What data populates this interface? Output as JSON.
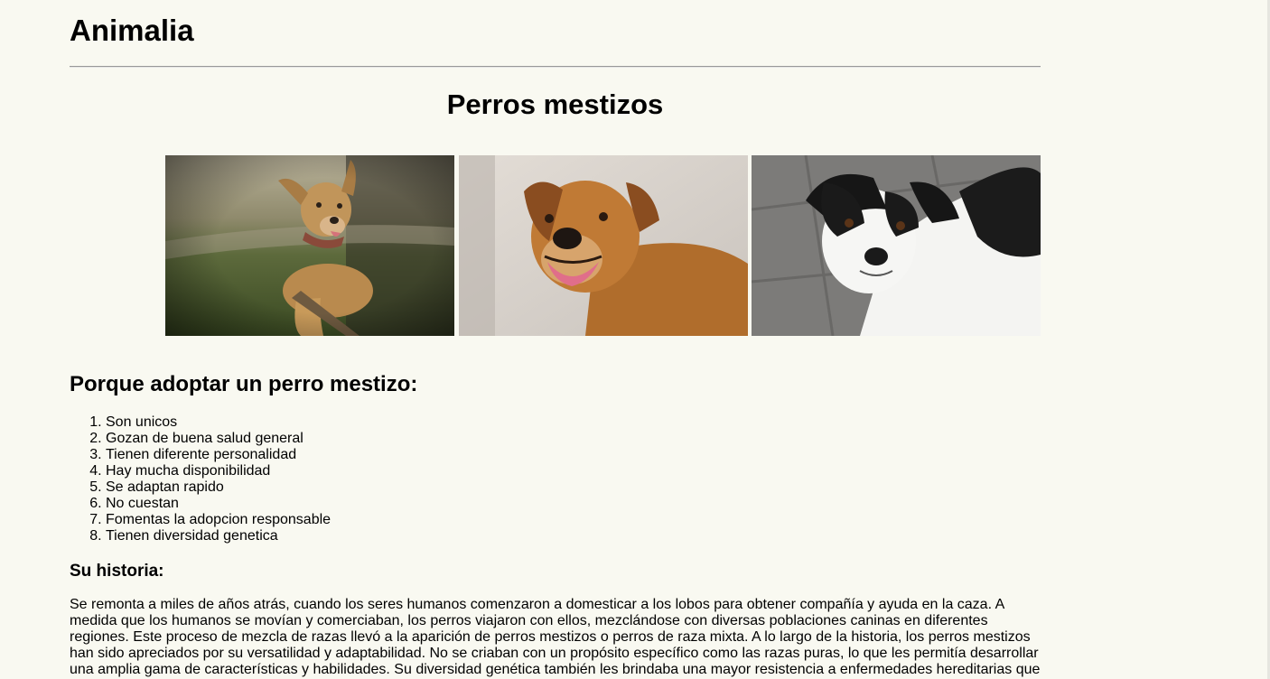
{
  "site": {
    "title": "Animalia"
  },
  "page": {
    "title": "Perros mestizos"
  },
  "gallery": {
    "images": [
      {
        "alt": "perro mestizo marrón en el césped con un palo"
      },
      {
        "alt": "perro mestizo color caramelo"
      },
      {
        "alt": "perro mestizo blanco y negro"
      }
    ]
  },
  "reasons": {
    "heading": "Porque adoptar un perro mestizo:",
    "items": [
      "Son unicos",
      "Gozan de buena salud general",
      "Tienen diferente personalidad",
      "Hay mucha disponibilidad",
      "Se adaptan rapido",
      "No cuestan",
      "Fomentas la adopcion responsable",
      "Tienen diversidad genetica"
    ]
  },
  "history": {
    "heading": "Su historia:",
    "text": "Se remonta a miles de años atrás, cuando los seres humanos comenzaron a domesticar a los lobos para obtener compañía y ayuda en la caza. A medida que los humanos se movían y comerciaban, los perros viajaron con ellos, mezclándose con diversas poblaciones caninas en diferentes regiones. Este proceso de mezcla de razas llevó a la aparición de perros mestizos o perros de raza mixta. A lo largo de la historia, los perros mestizos han sido apreciados por su versatilidad y adaptabilidad. No se criaban con un propósito específico como las razas puras, lo que les permitía desarrollar una amplia gama de características y habilidades. Su diversidad genética también les brindaba una mayor resistencia a enfermedades hereditarias que"
  },
  "colors": {
    "background": "#f9f9f1",
    "text": "#000000",
    "rule": "#999999"
  }
}
